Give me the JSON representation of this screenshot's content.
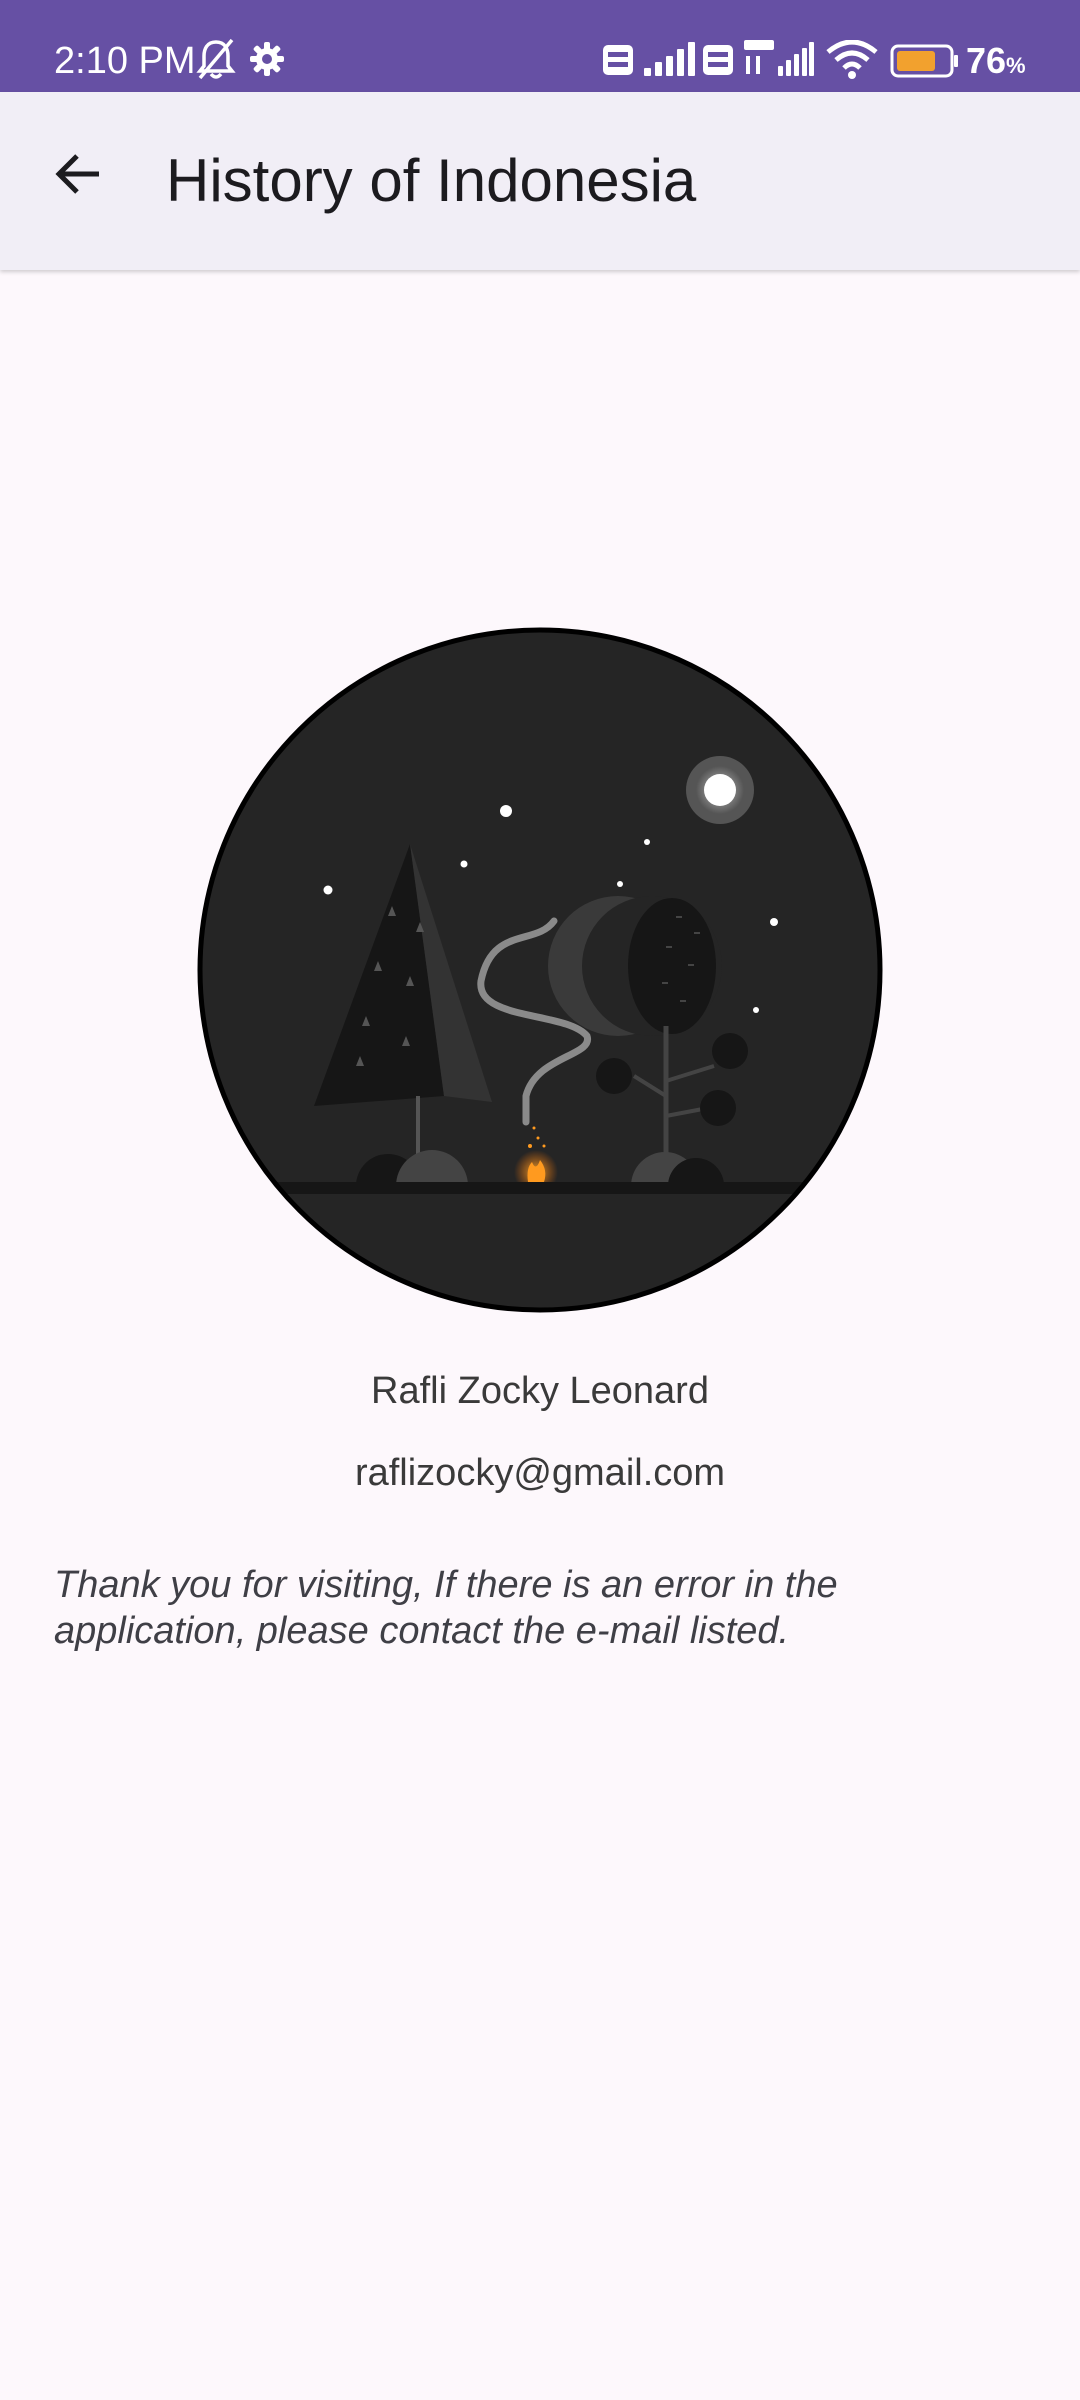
{
  "status_bar": {
    "time": "2:10 PM",
    "battery_value": "76",
    "battery_unit": "%",
    "battery_level": 0.76,
    "icons": [
      "bell-off-icon",
      "gear-icon",
      "volte-icon",
      "signal-icon",
      "volte-icon",
      "4g-plus-icon",
      "signal-icon",
      "wifi-icon",
      "battery-icon"
    ]
  },
  "app_bar": {
    "back_icon": "arrow-left-icon",
    "title": "History of Indonesia"
  },
  "profile": {
    "name": "Rafli Zocky Leonard",
    "email": "raflizocky@gmail.com",
    "message": "Thank you for visiting, If there is an error in the application, please contact the e-mail listed."
  },
  "colors": {
    "status_bar": "#6650a4",
    "app_bar": "#f1eef6",
    "background": "#fdf8fc",
    "avatar_bg": "#252525"
  }
}
